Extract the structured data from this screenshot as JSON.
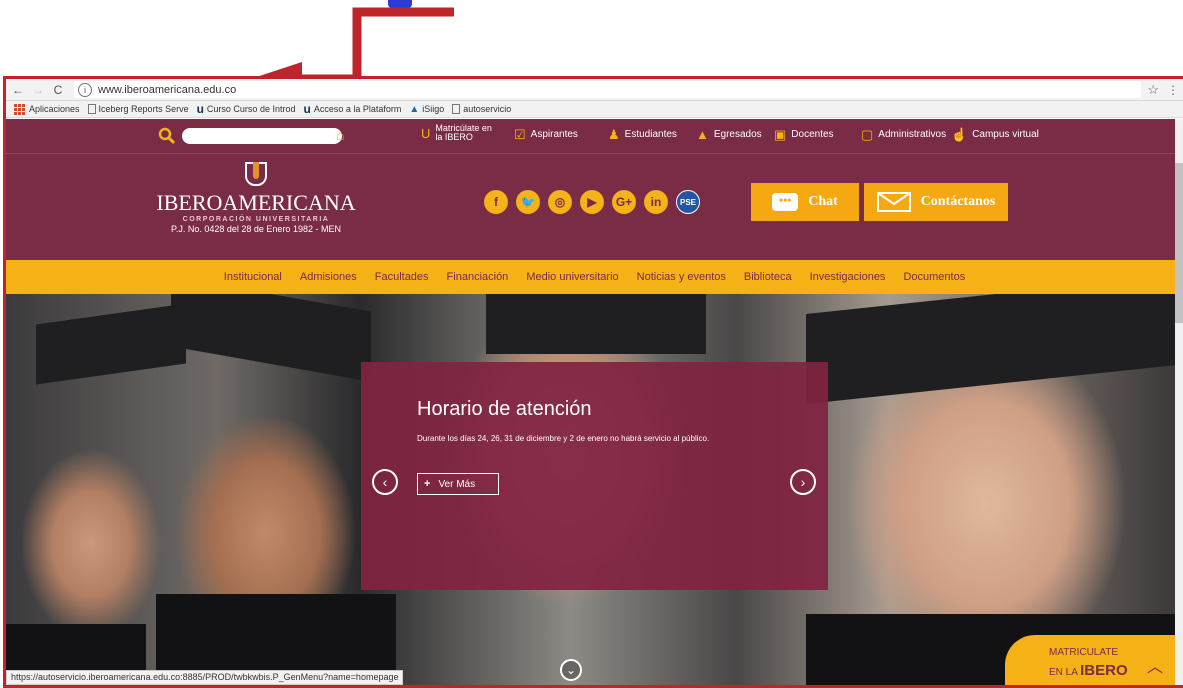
{
  "browser": {
    "nav": {
      "back": "←",
      "forward": "→",
      "reload": "C"
    },
    "url": "www.iberoamericana.edu.co",
    "star": "☆",
    "menu": "⋮",
    "bookmarks": [
      {
        "label": "Aplicaciones",
        "icon": "apps-icon"
      },
      {
        "label": "Iceberg Reports Serve",
        "icon": "page-icon"
      },
      {
        "label": "Curso Curso de Introd",
        "icon": "u-icon"
      },
      {
        "label": "Acceso a la Plataform",
        "icon": "u-icon"
      },
      {
        "label": "iSiigo",
        "icon": "ship-icon"
      },
      {
        "label": "autoservicio",
        "icon": "page-icon"
      }
    ],
    "status_url": "https://autoservicio.iberoamericana.edu.co:8885/PROD/twbkwbis.P_GenMenu?name=homepage"
  },
  "topnav": {
    "items": [
      {
        "label": "Matricúlate en",
        "label2": "la IBERO",
        "icon": "ibero-mark-icon"
      },
      {
        "label": "Aspirantes",
        "icon": "checkbox-icon"
      },
      {
        "label": "Estudiantes",
        "icon": "students-icon"
      },
      {
        "label": "Egresados",
        "icon": "graduation-cap-icon"
      },
      {
        "label": "Docentes",
        "icon": "teacher-icon"
      },
      {
        "label": "Administrativos",
        "icon": "document-icon"
      },
      {
        "label": "Campus virtual",
        "icon": "hand-pointer-icon"
      }
    ]
  },
  "brand": {
    "name": "IBEROAMERICANA",
    "sub": "CORPORACIÓN UNIVERSITARIA",
    "legal": "P.J. No. 0428 del 28 de Enero 1982 - MEN"
  },
  "social": [
    "f",
    "t",
    "ig",
    "yt",
    "G+",
    "in",
    "PSE"
  ],
  "header_buttons": {
    "chat": "Chat",
    "contact": "Contáctanos"
  },
  "mainnav": [
    "Institucional",
    "Admisiones",
    "Facultades",
    "Financiación",
    "Medio universitario",
    "Noticias y eventos",
    "Biblioteca",
    "Investigaciones",
    "Documentos"
  ],
  "promo": {
    "title": "Horario de atención",
    "text": "Durante los días 24, 26, 31 de diciembre y 2 de enero no habrá servicio al público.",
    "button": "Ver Más"
  },
  "matricula": {
    "line1": "MATRICULATE",
    "line2_pre": "EN LA",
    "line2_bold": "IBERO"
  },
  "colors": {
    "primary": "#7a2b45",
    "accent": "#f6b117",
    "annotation": "#c0242b"
  }
}
